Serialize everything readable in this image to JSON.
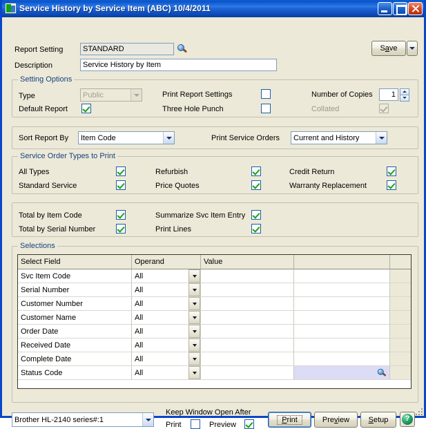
{
  "window": {
    "title": "Service History by Service Item (ABC) 10/4/2011",
    "app_icon": "report-app-icon",
    "minimize": "minimize-icon",
    "maximize": "maximize-icon",
    "close": "close-icon"
  },
  "header": {
    "report_setting_label": "Report Setting",
    "report_setting_value": "STANDARD",
    "lookup_icon": "magnifier-icon",
    "description_label": "Description",
    "description_value": "Service History by Item",
    "save_label": "Save",
    "save_menu_icon": "chevron-down-icon"
  },
  "setting_options": {
    "caption": "Setting Options",
    "type_label": "Type",
    "type_value": "Public",
    "default_report_label": "Default Report",
    "default_report_checked": true,
    "print_report_settings_label": "Print Report Settings",
    "print_report_settings_checked": false,
    "three_hole_punch_label": "Three Hole Punch",
    "three_hole_punch_checked": false,
    "number_of_copies_label": "Number of Copies",
    "number_of_copies_value": "1",
    "collated_label": "Collated",
    "collated_checked": true
  },
  "sort_row": {
    "sort_report_by_label": "Sort Report By",
    "sort_report_by_value": "Item Code",
    "print_service_orders_label": "Print Service Orders",
    "print_service_orders_value": "Current and History"
  },
  "order_types": {
    "caption": "Service Order Types to Print",
    "items": [
      {
        "label": "All Types",
        "checked": true
      },
      {
        "label": "Standard Service",
        "checked": true
      },
      {
        "label": "Refurbish",
        "checked": true
      },
      {
        "label": "Price Quotes",
        "checked": true
      },
      {
        "label": "Credit Return",
        "checked": true
      },
      {
        "label": "Warranty Replacement",
        "checked": true
      }
    ]
  },
  "totals": {
    "items": [
      {
        "label": "Total by Item Code",
        "checked": true
      },
      {
        "label": "Total by Serial Number",
        "checked": true
      },
      {
        "label": "Summarize Svc Item Entry",
        "checked": true
      },
      {
        "label": "Print Lines",
        "checked": true
      }
    ]
  },
  "selections": {
    "caption": "Selections",
    "columns": [
      "Select Field",
      "Operand",
      "Value",
      "",
      ""
    ],
    "rows": [
      {
        "field": "Svc Item Code",
        "operand": "All",
        "value": "",
        "value2": ""
      },
      {
        "field": "Serial Number",
        "operand": "All",
        "value": "",
        "value2": ""
      },
      {
        "field": "Customer Number",
        "operand": "All",
        "value": "",
        "value2": ""
      },
      {
        "field": "Customer Name",
        "operand": "All",
        "value": "",
        "value2": ""
      },
      {
        "field": "Order Date",
        "operand": "All",
        "value": "",
        "value2": ""
      },
      {
        "field": "Received Date",
        "operand": "All",
        "value": "",
        "value2": ""
      },
      {
        "field": "Complete Date",
        "operand": "All",
        "value": "",
        "value2": ""
      },
      {
        "field": "Status Code",
        "operand": "All",
        "value": "",
        "value2": "",
        "selected": true,
        "lookup_icon": "magnifier-icon"
      }
    ]
  },
  "footer": {
    "printer_value": "Brother HL-2140 series#:1",
    "keep_open_label": "Keep Window Open After",
    "print_label": "Print",
    "print_checked": false,
    "preview_label": "Preview",
    "preview_checked": true,
    "print_button": "Print",
    "preview_button": "Preview",
    "setup_button": "Setup",
    "help_icon": "help-icon",
    "help_glyph": "?"
  },
  "colors": {
    "window_bg": "#ece9d8",
    "title_blue": "#0a52c8",
    "group_caption": "#15417e",
    "check_green": "#17a017",
    "selected_cell": "#dcdcf6"
  }
}
